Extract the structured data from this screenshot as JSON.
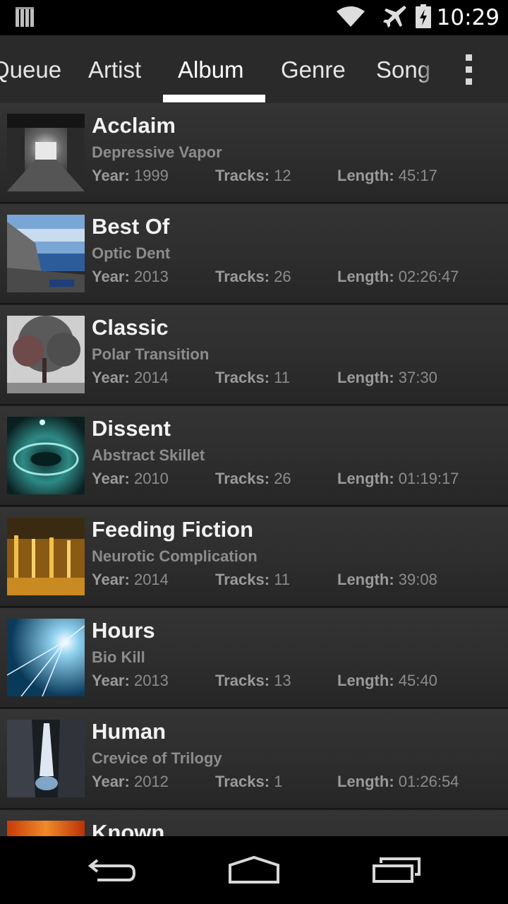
{
  "status_bar": {
    "time": "10:29",
    "icons": [
      "notification-icon",
      "wifi-icon",
      "airplane-mode-icon",
      "battery-charging-icon"
    ]
  },
  "tabs": [
    {
      "label": "Queue"
    },
    {
      "label": "Artist"
    },
    {
      "label": "Album",
      "active": true
    },
    {
      "label": "Genre"
    },
    {
      "label": "Song"
    }
  ],
  "menu_icon": "overflow-menu-icon",
  "labels": {
    "year": "Year:",
    "tracks": "Tracks:",
    "length": "Length:"
  },
  "albums": [
    {
      "title": "Acclaim",
      "artist": "Depressive Vapor",
      "year": "1999",
      "tracks": "12",
      "length": "45:17"
    },
    {
      "title": "Best Of",
      "artist": "Optic Dent",
      "year": "2013",
      "tracks": "26",
      "length": "02:26:47"
    },
    {
      "title": "Classic",
      "artist": "Polar Transition",
      "year": "2014",
      "tracks": "11",
      "length": "37:30"
    },
    {
      "title": "Dissent",
      "artist": "Abstract Skillet",
      "year": "2010",
      "tracks": "26",
      "length": "01:19:17"
    },
    {
      "title": "Feeding Fiction",
      "artist": "Neurotic Complication",
      "year": "2014",
      "tracks": "11",
      "length": "39:08"
    },
    {
      "title": "Hours",
      "artist": "Bio Kill",
      "year": "2013",
      "tracks": "13",
      "length": "45:40"
    },
    {
      "title": "Human",
      "artist": "Crevice of Trilogy",
      "year": "2012",
      "tracks": "1",
      "length": "01:26:54"
    },
    {
      "title": "Known"
    }
  ],
  "nav": [
    "back-icon",
    "home-icon",
    "recent-apps-icon"
  ]
}
